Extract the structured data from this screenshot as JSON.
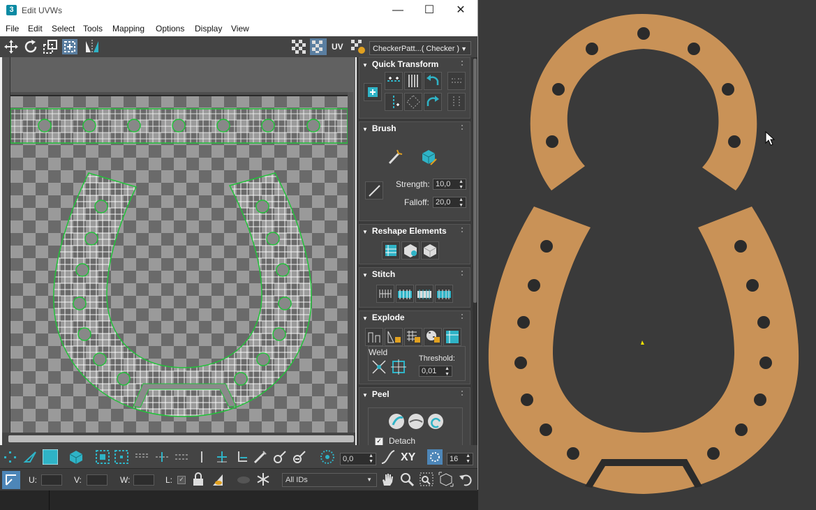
{
  "window": {
    "title": "Edit UVWs",
    "app_icon_text": "3",
    "minimize_glyph": "—",
    "maximize_glyph": "☐",
    "close_glyph": "✕"
  },
  "menu": [
    "File",
    "Edit",
    "Select",
    "Tools",
    "Mapping",
    "Options",
    "Display",
    "View"
  ],
  "toolbar": {
    "uv_label": "UV",
    "texture_dropdown": "CheckerPatt...( Checker )"
  },
  "panels": {
    "quick_transform": {
      "title": "Quick Transform"
    },
    "brush": {
      "title": "Brush",
      "strength_label": "Strength:",
      "strength_value": "10,0",
      "falloff_label": "Falloff:",
      "falloff_value": "20,0"
    },
    "reshape": {
      "title": "Reshape Elements"
    },
    "stitch": {
      "title": "Stitch"
    },
    "explode": {
      "title": "Explode",
      "weld_label": "Weld",
      "threshold_label": "Threshold:",
      "threshold_value": "0,01"
    },
    "peel": {
      "title": "Peel",
      "detach_label": "Detach",
      "detach_checked": true
    }
  },
  "bottom_bar": {
    "angle_value": "0,0",
    "xy_label": "XY",
    "grid_value": "16",
    "u_label": "U:",
    "v_label": "V:",
    "w_label": "W:",
    "l_label": "L:",
    "id_filter": "All IDs"
  },
  "colors": {
    "accent": "#2fb3c6",
    "selection": "#22c23a",
    "horseshoe": "#c99257",
    "viewport_bg": "#3a3a3a"
  },
  "icons": [
    "move-icon",
    "rotate-icon",
    "freeform-icon",
    "mirror-icon",
    "checker-icon",
    "lock-icon",
    "snowflake-icon",
    "pan-hand-icon",
    "zoom-icon",
    "undo-icon"
  ]
}
